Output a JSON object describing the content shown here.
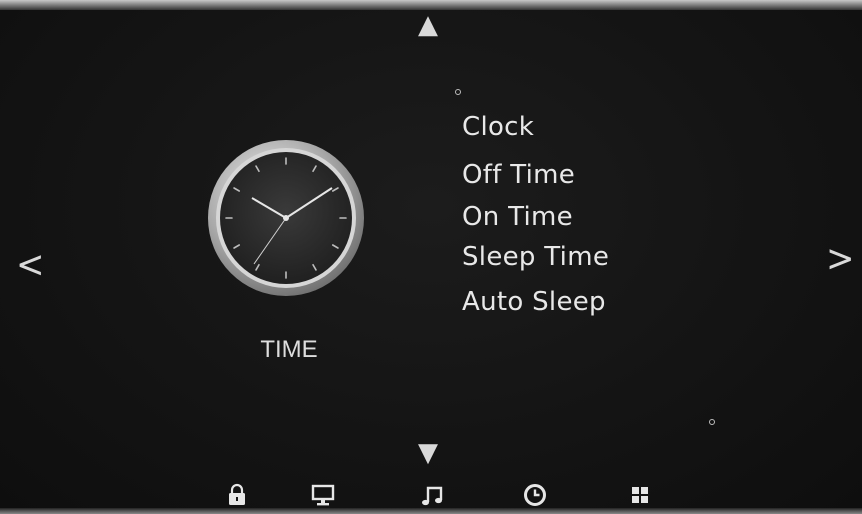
{
  "screen": {
    "title": "TIME"
  },
  "nav": {
    "up_icon": "triangle-up-icon",
    "down_icon": "triangle-down-icon",
    "left_icon": "chevron-left-icon",
    "right_icon": "chevron-right-icon",
    "up_glyph": "▲",
    "down_glyph": "▼",
    "left_glyph": "<",
    "right_glyph": ">"
  },
  "menu": {
    "items": [
      {
        "label": "Clock"
      },
      {
        "label": "Off Time"
      },
      {
        "label": "On Time"
      },
      {
        "label": "Sleep Time"
      },
      {
        "label": "Auto Sleep"
      }
    ]
  },
  "dock": {
    "items": [
      {
        "icon": "lock-icon"
      },
      {
        "icon": "monitor-icon"
      },
      {
        "icon": "music-note-icon"
      },
      {
        "icon": "clock-icon"
      },
      {
        "icon": "grid-icon"
      }
    ]
  },
  "colors": {
    "background": "#141414",
    "text": "#e8e8e8",
    "clock_bezel": "#c9c9c9",
    "clock_face": "#2b2b2b"
  }
}
